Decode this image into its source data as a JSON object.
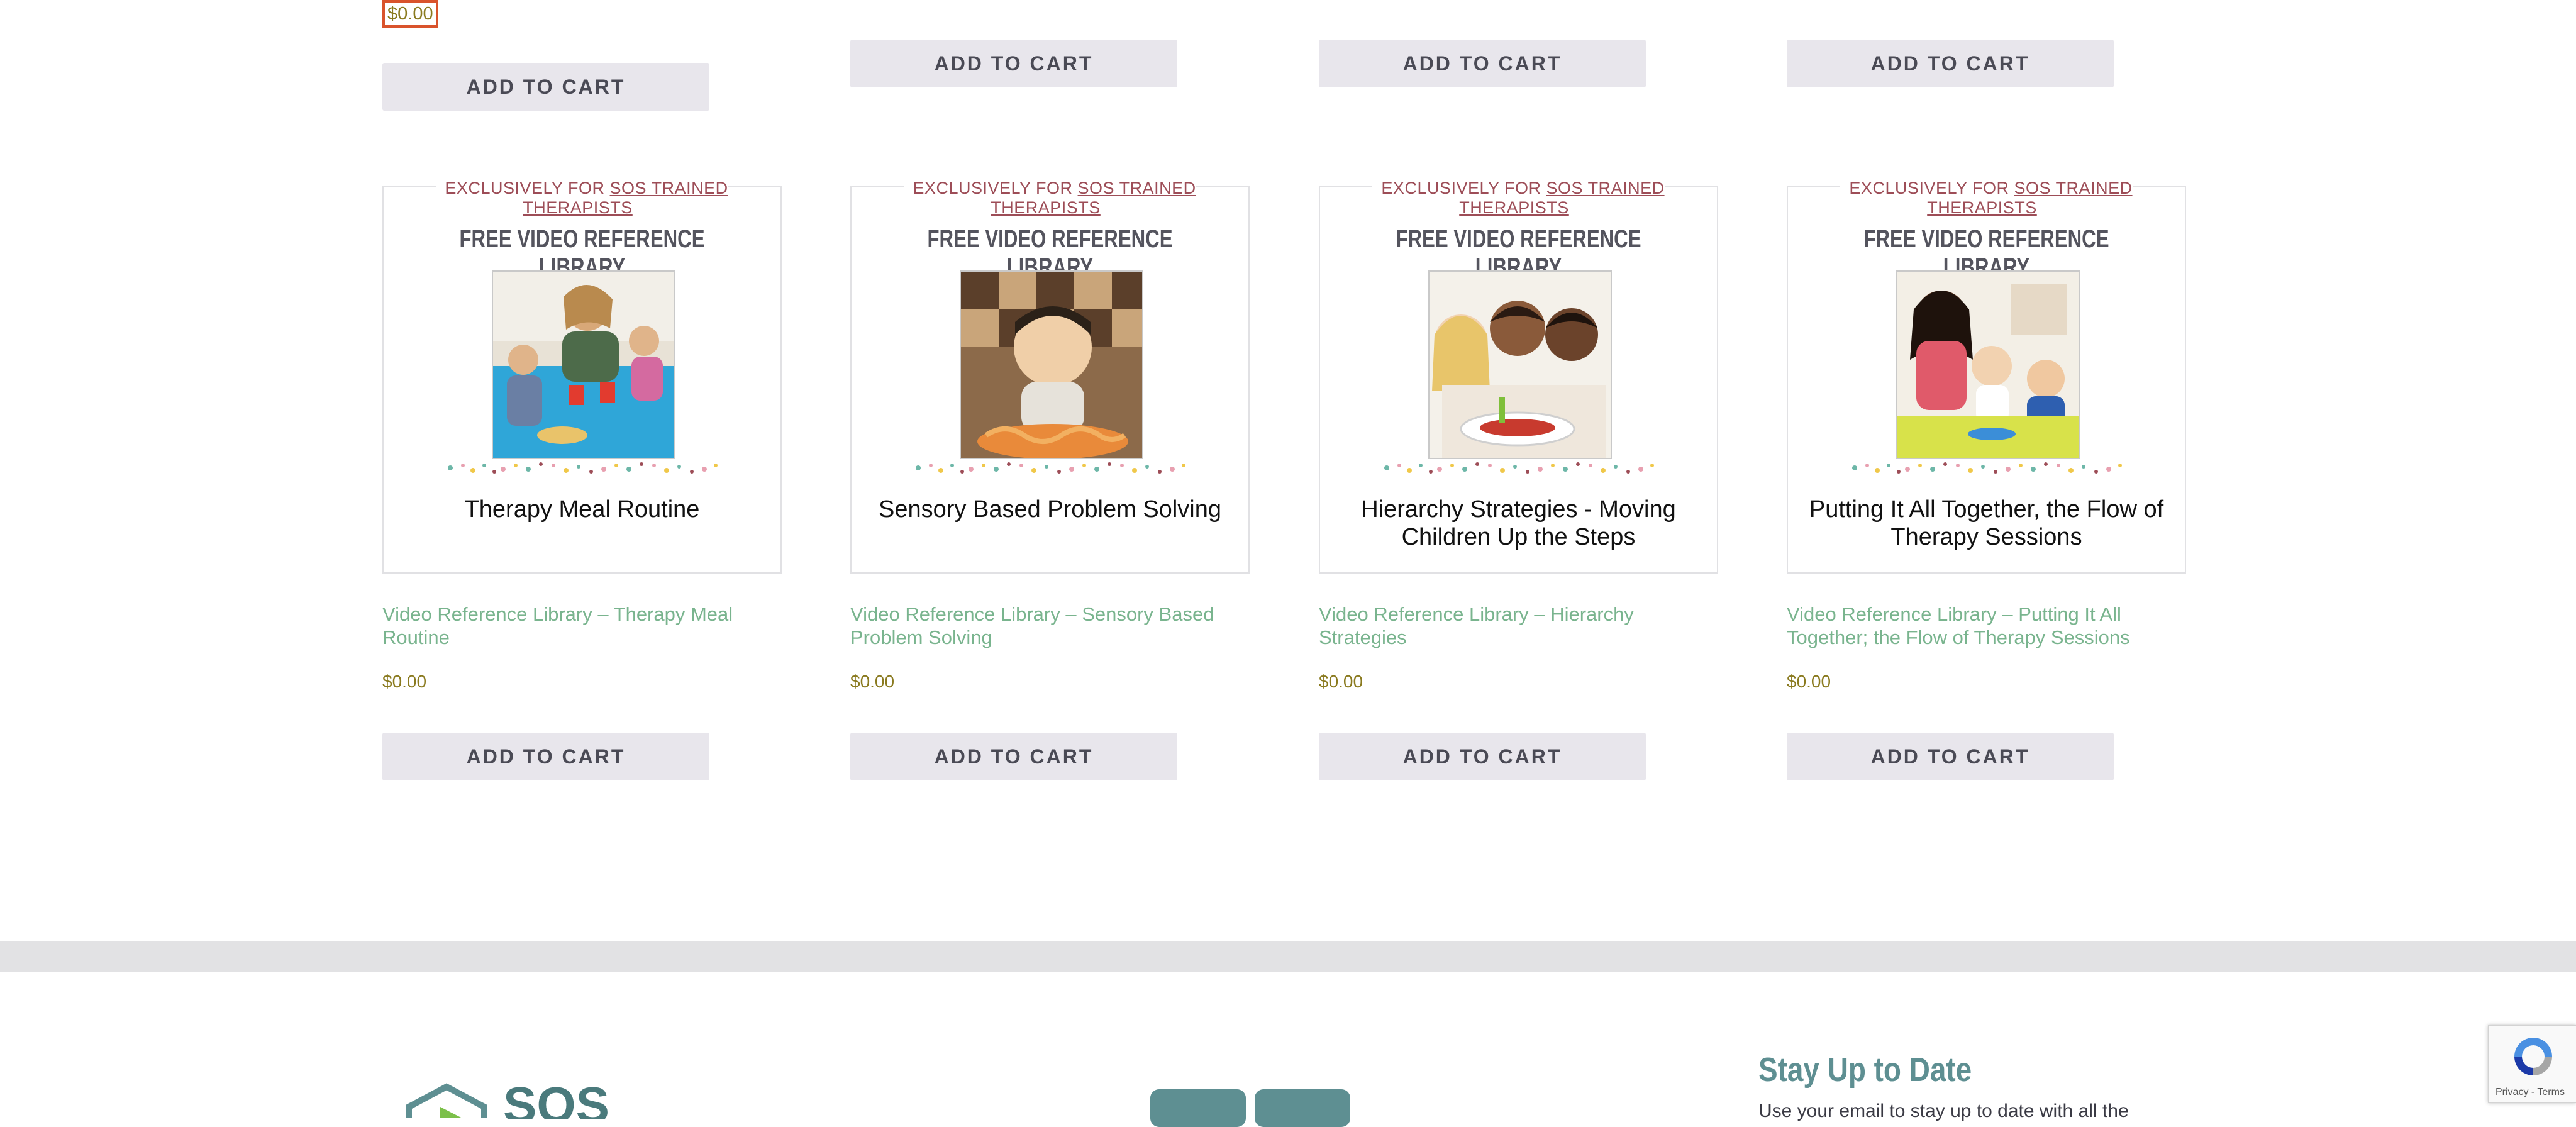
{
  "top_row": {
    "price": "$0.00",
    "add_to_cart": [
      "ADD TO CART",
      "ADD TO CART",
      "ADD TO CART",
      "ADD TO CART"
    ]
  },
  "products": [
    {
      "exclusive_prefix": "EXCLUSIVELY FOR",
      "exclusive_link": "SOS TRAINED THERAPISTS",
      "library_title": "FREE VIDEO REFERENCE LIBRARY",
      "session_title": "Therapy Meal Routine",
      "product_title": "Video Reference Library – Therapy Meal Routine",
      "price": "$0.00",
      "button": "ADD TO CART"
    },
    {
      "exclusive_prefix": "EXCLUSIVELY FOR",
      "exclusive_link": "SOS TRAINED THERAPISTS",
      "library_title": "FREE VIDEO REFERENCE LIBRARY",
      "session_title": "Sensory Based Problem Solving",
      "product_title": "Video Reference Library – Sensory Based Problem Solving",
      "price": "$0.00",
      "button": "ADD TO CART"
    },
    {
      "exclusive_prefix": "EXCLUSIVELY FOR",
      "exclusive_link": "SOS TRAINED THERAPISTS",
      "library_title": "FREE VIDEO REFERENCE LIBRARY",
      "session_title": "Hierarchy Strategies - Moving Children Up the Steps",
      "product_title": "Video Reference Library – Hierarchy Strategies",
      "price": "$0.00",
      "button": "ADD TO CART"
    },
    {
      "exclusive_prefix": "EXCLUSIVELY FOR",
      "exclusive_link": "SOS TRAINED THERAPISTS",
      "library_title": "FREE VIDEO REFERENCE LIBRARY",
      "session_title": "Putting It All Together, the Flow of Therapy Sessions",
      "product_title": "Video Reference Library – Putting It All Together; the Flow of Therapy Sessions",
      "price": "$0.00",
      "button": "ADD TO CART"
    }
  ],
  "footer": {
    "logo_text": "SOS",
    "stay_title": "Stay Up to Date",
    "stay_text": "Use your email to stay up to date with all the"
  },
  "recaptcha": {
    "terms": "Privacy - Terms"
  },
  "colors": {
    "price": "#8a7a1f",
    "product_link": "#79b48e",
    "exclusive": "#9d4d57",
    "footer_accent": "#5e8f92"
  }
}
